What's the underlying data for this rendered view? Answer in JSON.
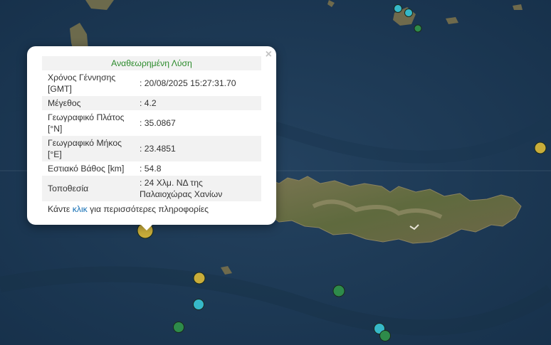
{
  "popup": {
    "title": "Αναθεωρημένη Λύση",
    "close_symbol": "×",
    "rows": [
      {
        "label": "Χρόνος Γέννησης [GMT]",
        "value": ": 20/08/2025 15:27:31.70"
      },
      {
        "label": "Μέγεθος",
        "value": ": 4.2"
      },
      {
        "label": "Γεωγραφικό Πλάτος [°N]",
        "value": ": 35.0867"
      },
      {
        "label": "Γεωγραφικό Μήκος [°E]",
        "value": ": 23.4851"
      },
      {
        "label": "Εστιακό Βάθος [km]",
        "value": ": 54.8"
      },
      {
        "label": "Τοποθεσία",
        "value": ": 24 Χλμ. ΝΔ της Παλαιοχώρας Χανίων"
      }
    ],
    "more": {
      "prefix": "Κάντε ",
      "link": "κλικ",
      "suffix": " για περισσότερες πληροφορίες"
    }
  },
  "colors": {
    "sea": "#1e3a56",
    "land": "#6f6a4c",
    "title_green": "#2a8a2a",
    "link_blue": "#1670b5",
    "marker_yellow": "#c9ad3a",
    "marker_cyan": "#36b8c8",
    "marker_green": "#2e8b4a"
  },
  "markers": [
    {
      "color": "yellow",
      "size": "large"
    },
    {
      "color": "yellow",
      "size": "small"
    },
    {
      "color": "yellow",
      "size": "small"
    },
    {
      "color": "cyan",
      "size": "small"
    },
    {
      "color": "cyan",
      "size": "small"
    },
    {
      "color": "cyan",
      "size": "small"
    },
    {
      "color": "cyan",
      "size": "small"
    },
    {
      "color": "green",
      "size": "small"
    },
    {
      "color": "green",
      "size": "small"
    },
    {
      "color": "green",
      "size": "small"
    },
    {
      "color": "green",
      "size": "small"
    }
  ]
}
